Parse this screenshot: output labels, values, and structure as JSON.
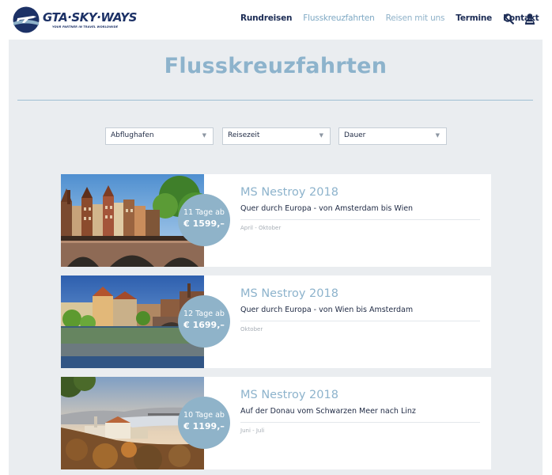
{
  "brand": {
    "name": "GTA·SKY·WAYS",
    "tagline": "YOUR PARTNER IN TRAVEL WORLDWIDE",
    "primary_color": "#1c3166",
    "accent_color": "#8db3cc"
  },
  "nav": {
    "items": [
      {
        "label": "Rundreisen"
      },
      {
        "label": "Flusskreuzfahrten"
      },
      {
        "label": "Reisen mit uns"
      },
      {
        "label": "Termine"
      },
      {
        "label": "Kontakt"
      }
    ],
    "icons": [
      "search-icon",
      "user-icon"
    ]
  },
  "page": {
    "title": "Flusskreuzfahrten"
  },
  "filters": [
    {
      "label": "Abflughafen"
    },
    {
      "label": "Reisezeit"
    },
    {
      "label": "Dauer"
    }
  ],
  "tours": [
    {
      "days": "11 Tage ab",
      "price": "€ 1599,–",
      "title": "MS Nestroy 2018",
      "subtitle": "Quer durch Europa - von Amsterdam bis Wien",
      "period": "April - Oktober"
    },
    {
      "days": "12 Tage ab",
      "price": "€ 1699,–",
      "title": "MS Nestroy 2018",
      "subtitle": "Quer durch Europa - von Wien bis Amsterdam",
      "period": "Oktober"
    },
    {
      "days": "10 Tage ab",
      "price": "€ 1199,–",
      "title": "MS Nestroy 2018",
      "subtitle": "Auf der Donau vom Schwarzen Meer nach Linz",
      "period": "Juni - Juli"
    }
  ]
}
